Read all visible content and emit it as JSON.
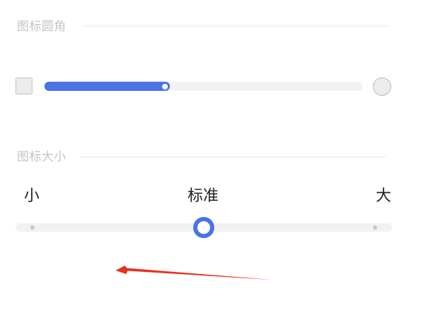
{
  "icon_corner": {
    "title": "图标圆角",
    "value_fraction": 0.38
  },
  "icon_size": {
    "title": "图标大小",
    "options": [
      "小",
      "标准",
      "大"
    ],
    "selected_index": 1
  },
  "colors": {
    "accent": "#4a73e8",
    "track": "#f1f2f4",
    "annotation": "#e8301f"
  }
}
